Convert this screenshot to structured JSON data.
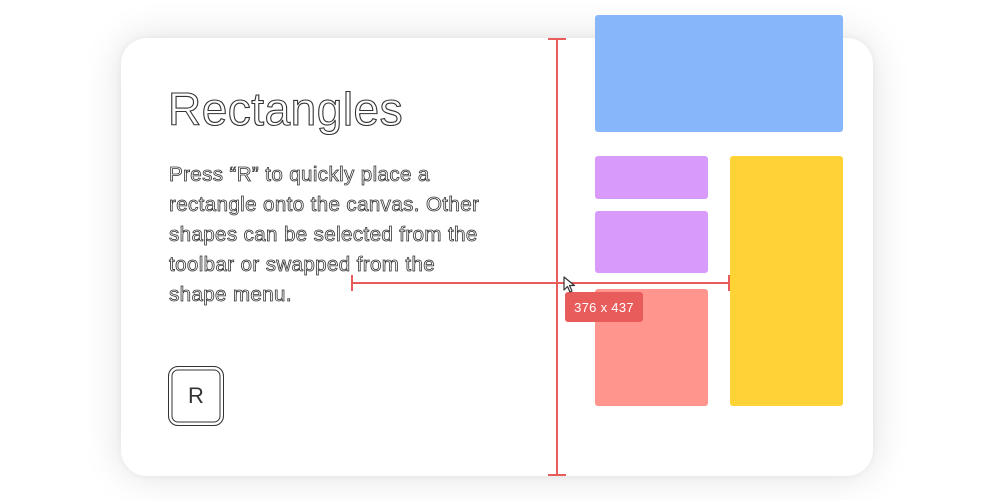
{
  "panel": {
    "title": "Rectangles",
    "description_lines": [
      "Press “R” to quickly place a",
      "rectangle onto the canvas. Other",
      "shapes can be selected from the",
      "toolbar or swapped from the",
      "shape menu."
    ],
    "shortcut_key": "R"
  },
  "canvas": {
    "dimension_label": "376 x 437",
    "cursor_icon": "resize-cursor-icon"
  },
  "colors": {
    "blue": "#88b6fb",
    "purple": "#d99bfb",
    "salmon": "#ff958c",
    "yellow": "#ffd236",
    "guide": "#e85c5c"
  }
}
